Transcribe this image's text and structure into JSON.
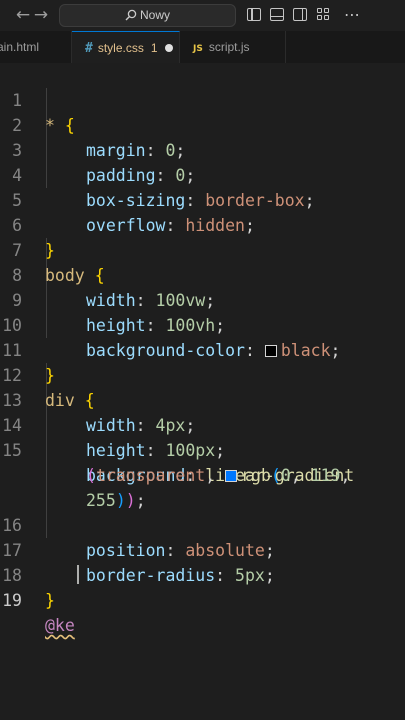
{
  "titlebar": {
    "search_placeholder": "Nowy",
    "back_glyph": "←",
    "forward_glyph": "→",
    "more_glyph": "⋯",
    "icons": [
      "arrow-left-icon",
      "arrow-right-icon",
      "search-icon",
      "toggle-primary-sidebar-icon",
      "toggle-panel-icon",
      "toggle-secondary-sidebar-icon",
      "customize-layout-icon"
    ]
  },
  "tabs": [
    {
      "label": "ain.html",
      "active": false
    },
    {
      "label": "style.css",
      "icon": "#",
      "badge": "1",
      "active": true,
      "modified": true
    },
    {
      "label": "script.js",
      "icon": "JS",
      "active": false
    }
  ],
  "editor": {
    "language": "css",
    "colors": {
      "background": "#1e1e1e",
      "selector": "#d7ba7d",
      "property": "#9cdcfe",
      "number": "#b5cea8",
      "value": "#ce9178",
      "function": "#dcdcaa",
      "bracket_gold": "#ffd700",
      "bracket_purple": "#da70d6",
      "bracket_blue": "#179fff"
    },
    "lines": [
      {
        "number": "1",
        "text": "* {"
      },
      {
        "number": "2",
        "text": "margin: 0;"
      },
      {
        "number": "3",
        "text": "padding: 0;"
      },
      {
        "number": "4",
        "text": "box-sizing: border-box;"
      },
      {
        "number": "5",
        "text": "overflow: hidden;"
      },
      {
        "number": "6",
        "text": "}"
      },
      {
        "number": "7",
        "text": "body {"
      },
      {
        "number": "8",
        "text": "width: 100vw;"
      },
      {
        "number": "9",
        "text": "height: 100vh;"
      },
      {
        "number": "10",
        "text": "background-color: black;"
      },
      {
        "number": "11",
        "text": "}"
      },
      {
        "number": "12",
        "text": "div {"
      },
      {
        "number": "13",
        "text": "width: 4px;"
      },
      {
        "number": "14",
        "text": "height: 100px;"
      },
      {
        "number": "15",
        "text": "background: linear-gradient(transparent, rgb(0, 119, 255));"
      },
      {
        "number": "16",
        "text": "position: absolute;"
      },
      {
        "number": "17",
        "text": "border-radius: 5px;"
      },
      {
        "number": "18",
        "text": "}"
      },
      {
        "number": "19",
        "text": "@ke",
        "active": true
      }
    ],
    "tokens": {
      "star": "*",
      "body_sel": "body",
      "div_sel": "div",
      "open": "{",
      "close": "}",
      "margin": "margin",
      "padding": "padding",
      "box_sizing": "box-sizing",
      "overflow": "overflow",
      "width": "width",
      "height": "height",
      "background_color": "background-color",
      "background": "background",
      "position": "position",
      "border_radius": "border-radius",
      "zero": "0",
      "border_box": "border-box",
      "hidden": "hidden",
      "v100vw": "100vw",
      "v100vh": "100vh",
      "black": "black",
      "v4px": "4px",
      "v100px": "100px",
      "linear_gradient": "linear-gradient",
      "transparent": "transparent",
      "rgb": "rgb",
      "n0": "0",
      "n119": "119",
      "n255": "255",
      "absolute": "absolute",
      "v5px": "5px",
      "at_ke": "@ke"
    },
    "swatches": {
      "black": "#000000",
      "blue": "#0077ff"
    }
  }
}
